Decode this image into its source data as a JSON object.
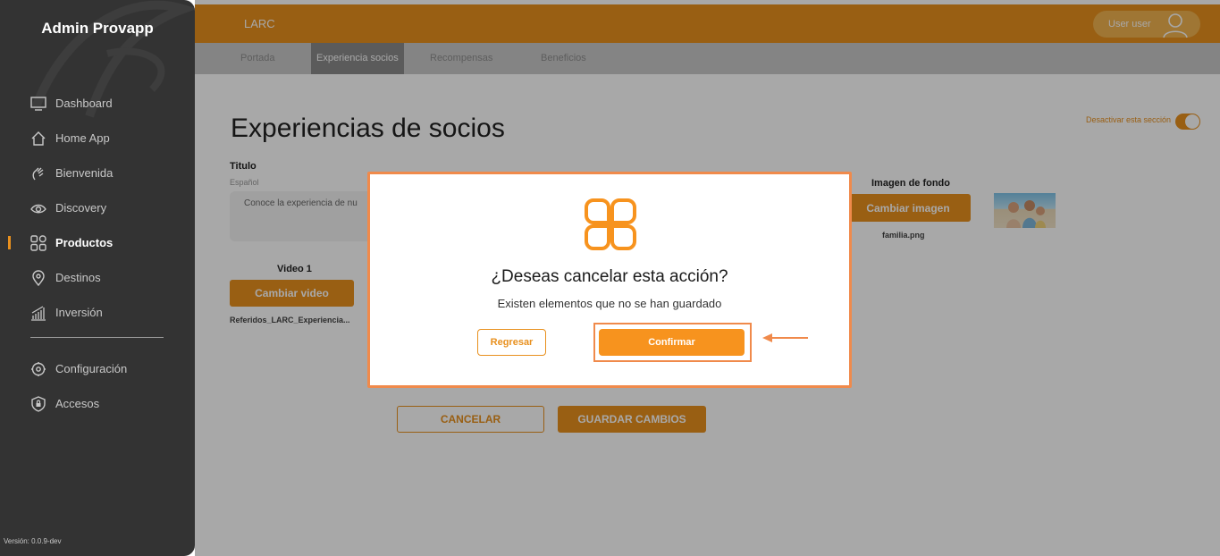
{
  "app": {
    "brand": "Admin Provapp",
    "version": "Versión: 0.0.9-dev"
  },
  "sidebar": {
    "items": [
      {
        "label": "Dashboard",
        "icon": "monitor-icon"
      },
      {
        "label": "Home App",
        "icon": "house-icon"
      },
      {
        "label": "Bienvenida",
        "icon": "waving-hand-icon"
      },
      {
        "label": "Discovery",
        "icon": "eye-icon"
      },
      {
        "label": "Productos",
        "icon": "grid-icon",
        "active": true
      },
      {
        "label": "Destinos",
        "icon": "location-pin-icon"
      },
      {
        "label": "Inversión",
        "icon": "bar-chart-icon"
      }
    ],
    "bottom_items": [
      {
        "label": "Configuración",
        "icon": "gear-icon"
      },
      {
        "label": "Accesos",
        "icon": "shield-lock-icon"
      }
    ]
  },
  "header": {
    "breadcrumb": "LARC",
    "user_name": "User user"
  },
  "tabs": [
    {
      "label": "Portada"
    },
    {
      "label": "Experiencia socios",
      "active": true
    },
    {
      "label": "Recompensas"
    },
    {
      "label": "Beneficios"
    }
  ],
  "page": {
    "title": "Experiencias de socios",
    "deactivate_label": "Desactivar esta sección",
    "titulo_label": "Titulo",
    "idioma_label": "Español",
    "titulo_value": "Conoce la experiencia de nu",
    "video_label": "Video 1",
    "change_video": "Cambiar video",
    "video_filename": "Referidos_LARC_Experiencia...",
    "bg_label": "Imagen de fondo",
    "change_image": "Cambiar imagen",
    "image_filename": "familia.png",
    "cancel": "CANCELAR",
    "save": "GUARDAR CAMBIOS"
  },
  "modal": {
    "title": "¿Deseas cancelar esta acción?",
    "subtitle": "Existen elementos que no se han guardado",
    "back": "Regresar",
    "confirm": "Confirmar"
  },
  "colors": {
    "accent": "#e8901e",
    "sidebar": "#333333",
    "highlight": "#f08a4b"
  }
}
